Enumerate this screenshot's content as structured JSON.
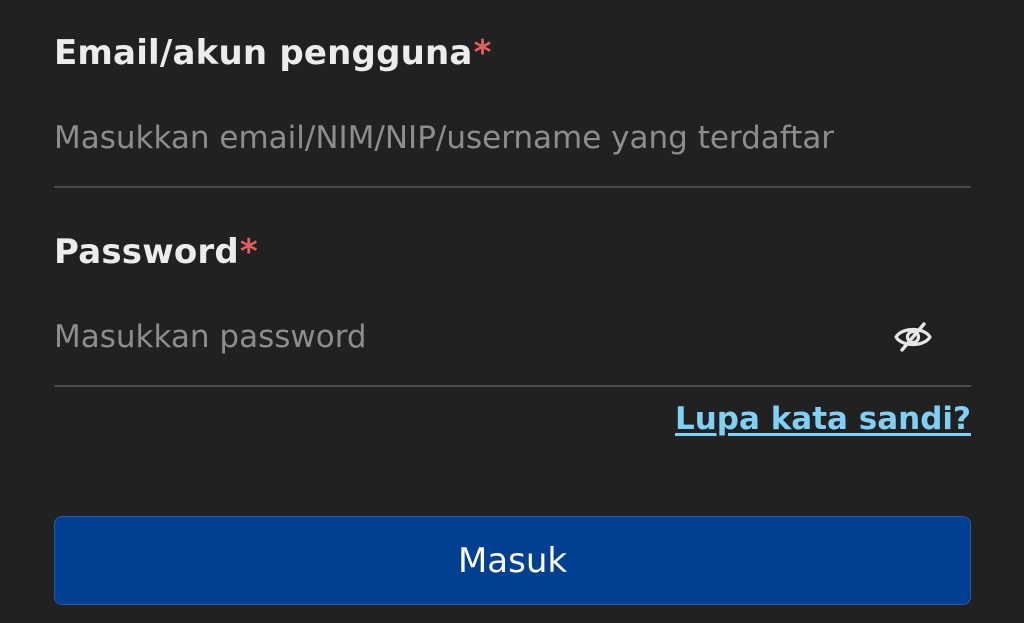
{
  "login_form": {
    "email": {
      "label": "Email/akun pengguna",
      "required_mark": "*",
      "placeholder": "Masukkan email/NIM/NIP/username yang terdaftar",
      "value": ""
    },
    "password": {
      "label": "Password",
      "required_mark": "*",
      "placeholder": "Masukkan password",
      "value": "",
      "toggle_icon": "eye-slash-icon"
    },
    "forgot_password_link": "Lupa kata sandi?",
    "submit_button": "Masuk"
  },
  "colors": {
    "background": "#212121",
    "label": "#ececec",
    "required": "#e06060",
    "placeholder": "#8d8d8d",
    "divider": "#4a4a4a",
    "link": "#7fd0f5",
    "button": "#003f92",
    "button_text": "#ffffff"
  }
}
